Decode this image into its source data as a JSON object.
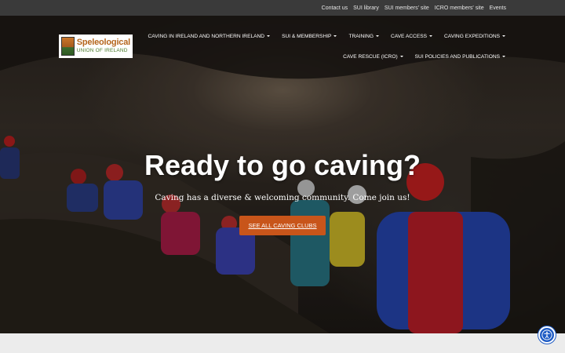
{
  "topbar": {
    "links": [
      "Contact us",
      "SUI library",
      "SUI members' site",
      "ICRO members' site",
      "Events"
    ]
  },
  "logo": {
    "line1": "Speleological",
    "line2": "UNION OF IRELAND"
  },
  "nav": {
    "row1": [
      "CAVING IN IRELAND AND NORTHERN IRELAND",
      "SUI & MEMBERSHIP",
      "TRAINING",
      "CAVE ACCESS",
      "CAVING EXPEDITIONS"
    ],
    "row2": [
      "CAVE RESCUE (ICRO)",
      "SUI POLICIES AND PUBLICATIONS"
    ]
  },
  "hero": {
    "headline": "Ready to go caving?",
    "subline": "Caving has a diverse & welcoming community. Come join us!",
    "cta_label": "SEE ALL CAVING CLUBS"
  },
  "accessibility_icon": "accessibility-icon",
  "colors": {
    "cta": "#c8551a",
    "topbar": "#3a3a3a",
    "accessibility": "#1e5bc4"
  }
}
